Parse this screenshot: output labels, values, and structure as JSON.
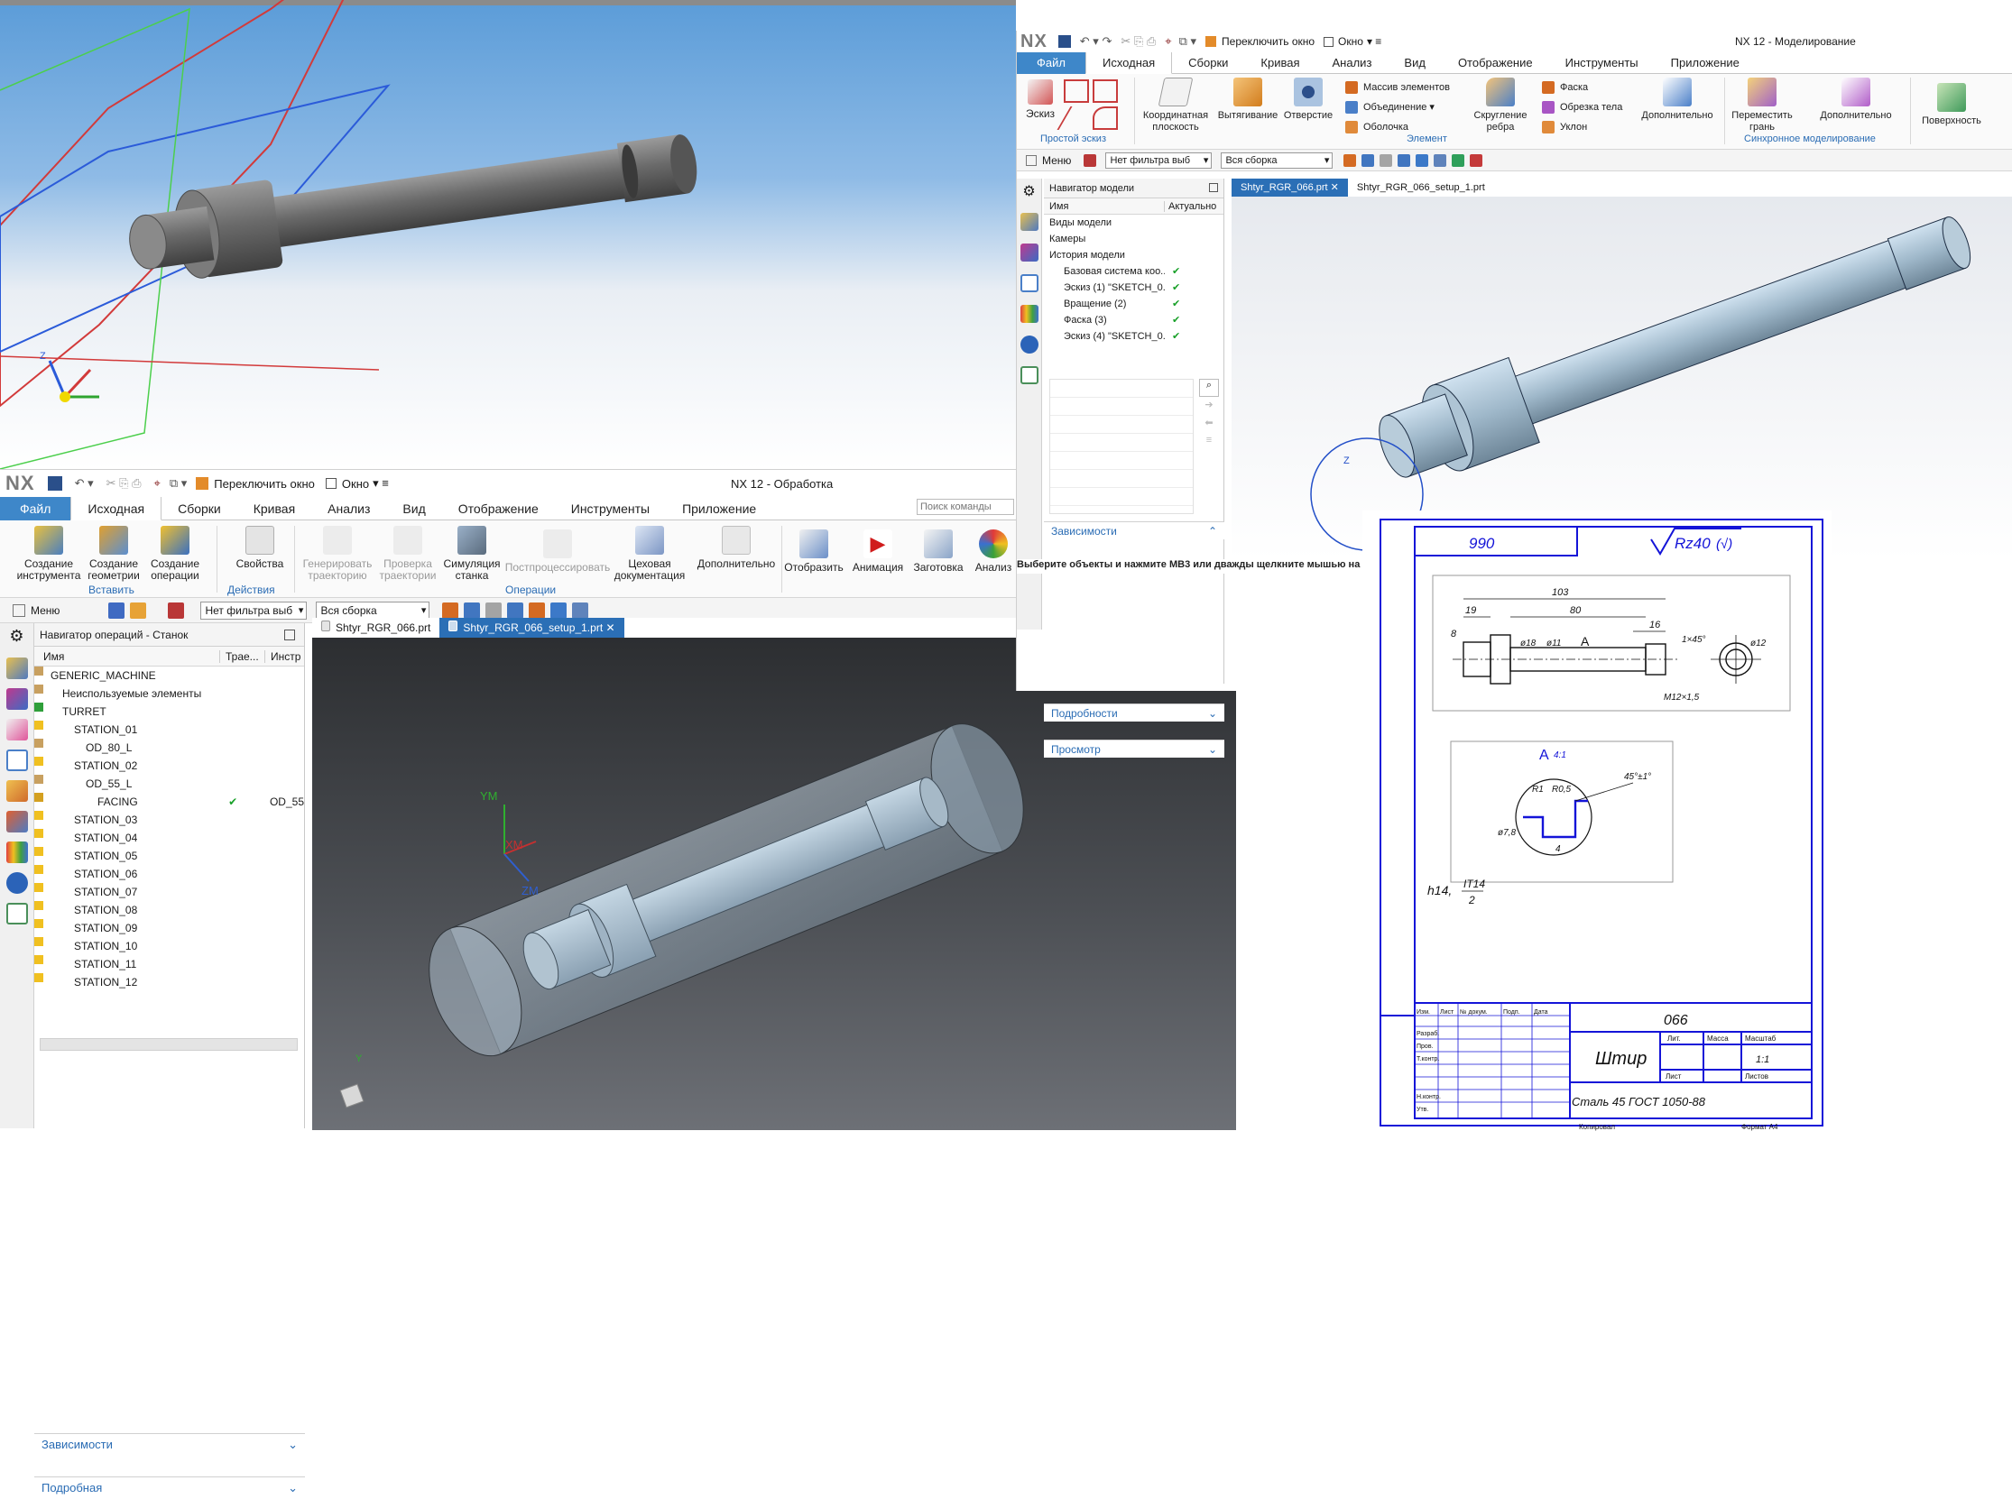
{
  "cam_window": {
    "title": "NX 12 - Обработка",
    "quick": {
      "switch_window": "Переключить окно",
      "window_menu": "Окно"
    },
    "logo": "NX",
    "tabs": [
      "Файл",
      "Исходная",
      "Сборки",
      "Кривая",
      "Анализ",
      "Вид",
      "Отображение",
      "Инструменты",
      "Приложение"
    ],
    "search_placeholder": "Поиск команды",
    "ribbon": {
      "insert": [
        "Создание инструмента",
        "Создание геометрии",
        "Создание операции"
      ],
      "insert_label": "Вставить",
      "actions": [
        "Свойства"
      ],
      "actions_label": "Действия",
      "operations": [
        "Генерировать траекторию",
        "Проверка траектории",
        "Симуляция станка",
        "Постпроцессировать",
        "Цеховая документация",
        "Дополнительно"
      ],
      "operations_label": "Операции",
      "extra": [
        "Отобразить",
        "Анимация",
        "Заготовка",
        "Анализ"
      ]
    },
    "cmdbar": {
      "menu": "Меню",
      "filter": "Нет фильтра выб",
      "assembly": "Вся сборка"
    },
    "navigator": {
      "title": "Навигатор операций - Станок",
      "columns": [
        "Имя",
        "Трае...",
        "Инстр"
      ],
      "rows": [
        {
          "name": "GENERIC_MACHINE",
          "traj": "",
          "tool": ""
        },
        {
          "name": "Неиспользуемые элементы",
          "traj": "",
          "tool": ""
        },
        {
          "name": "TURRET",
          "traj": "",
          "tool": ""
        },
        {
          "name": "STATION_01",
          "traj": "",
          "tool": ""
        },
        {
          "name": "OD_80_L",
          "traj": "",
          "tool": ""
        },
        {
          "name": "STATION_02",
          "traj": "",
          "tool": ""
        },
        {
          "name": "OD_55_L",
          "traj": "",
          "tool": ""
        },
        {
          "name": "FACING",
          "traj": "✔",
          "tool": "OD_55"
        },
        {
          "name": "STATION_03",
          "traj": "",
          "tool": ""
        },
        {
          "name": "STATION_04",
          "traj": "",
          "tool": ""
        },
        {
          "name": "STATION_05",
          "traj": "",
          "tool": ""
        },
        {
          "name": "STATION_06",
          "traj": "",
          "tool": ""
        },
        {
          "name": "STATION_07",
          "traj": "",
          "tool": ""
        },
        {
          "name": "STATION_08",
          "traj": "",
          "tool": ""
        },
        {
          "name": "STATION_09",
          "traj": "",
          "tool": ""
        },
        {
          "name": "STATION_10",
          "traj": "",
          "tool": ""
        },
        {
          "name": "STATION_11",
          "traj": "",
          "tool": ""
        },
        {
          "name": "STATION_12",
          "traj": "",
          "tool": ""
        }
      ],
      "dependencies": "Зависимости",
      "details": "Подробная"
    },
    "doc_tabs": [
      "Shtyr_RGR_066.prt",
      "Shtyr_RGR_066_setup_1.prt"
    ],
    "axis_labels": {
      "ym": "YM",
      "xm": "XM",
      "zm": "ZM",
      "y": "Y"
    }
  },
  "model_window": {
    "title": "NX 12 - Моделирование",
    "quick": {
      "switch_window": "Переключить окно",
      "window_menu": "Окно"
    },
    "logo": "NX",
    "tabs": [
      "Файл",
      "Исходная",
      "Сборки",
      "Кривая",
      "Анализ",
      "Вид",
      "Отображение",
      "Инструменты",
      "Приложение"
    ],
    "ribbon": {
      "sketch": "Эскиз",
      "simple_sketch_label": "Простой эскиз",
      "feature": [
        "Координатная плоскость",
        "Вытягивание",
        "Отверстие"
      ],
      "feature_small": [
        "Массив элементов",
        "Объединение",
        "Оболочка"
      ],
      "edge": "Скругление ребра",
      "edge_small": [
        "Фаска",
        "Обрезка тела",
        "Уклон"
      ],
      "more": "Дополнительно",
      "feature_label": "Элемент",
      "sync": "Переместить грань",
      "sync_more": "Дополнительно",
      "sync_label": "Синхронное моделирование",
      "surface": "Поверхность"
    },
    "cmdbar": {
      "menu": "Меню",
      "filter": "Нет фильтра выб",
      "assembly": "Вся сборка"
    },
    "navigator": {
      "title": "Навигатор модели",
      "columns": [
        "Имя",
        "Актуально"
      ],
      "rows": [
        {
          "name": "Виды модели",
          "ok": ""
        },
        {
          "name": "Камеры",
          "ok": ""
        },
        {
          "name": "История модели",
          "ok": ""
        },
        {
          "name": "Базовая система коо...",
          "ok": "✔"
        },
        {
          "name": "Эскиз (1) \"SKETCH_0...",
          "ok": "✔"
        },
        {
          "name": "Вращение (2)",
          "ok": "✔"
        },
        {
          "name": "Фаска (3)",
          "ok": "✔"
        },
        {
          "name": "Эскиз (4) \"SKETCH_0...",
          "ok": "✔"
        }
      ],
      "dependencies": "Зависимости",
      "details": "Подробности",
      "preview": "Просмотр"
    },
    "doc_tabs": [
      "Shtyr_RGR_066.prt",
      "Shtyr_RGR_066_setup_1.prt"
    ],
    "status": "Выберите объекты и нажмите MB3 или дважды щелкните мышью на"
  },
  "drawing": {
    "number_top": "990",
    "roughness": "Rz40",
    "roughness_paren": "(√)",
    "dims": {
      "total": "103",
      "mid": "80",
      "left": "19",
      "d1": "8",
      "right": "16",
      "chamfer": "1×45°",
      "d18": "ø18",
      "d11": "ø11",
      "d12": "ø12",
      "thread": "M12×1,5"
    },
    "section_letter": "A",
    "section_scale": "4:1",
    "section": {
      "r1": "R1",
      "r05": "R0,5",
      "ch": "45°±1°",
      "d78": "ø7,8",
      "w": "4"
    },
    "tol": "h14,",
    "tol2": "IT14",
    "tol3": "2",
    "stamp": {
      "code": "066",
      "name": "Штир",
      "material": "Сталь 45 ГОСТ 1050-88",
      "mass_scale": "1:1",
      "headers": [
        "Лит.",
        "Масса",
        "Масштаб"
      ],
      "sheet": "Лист",
      "sheets": "Листов",
      "copied": "Копировал",
      "format": "Формат А4",
      "left_rows": [
        "Изм.",
        "Лист",
        "№ докум.",
        "Подп.",
        "Дата",
        "Разраб.",
        "Пров.",
        "Т.контр.",
        "Н.контр.",
        "Утв."
      ]
    }
  },
  "colors": {
    "file_tab": "#3e87c9",
    "accent_blue": "#2a6cb4",
    "drawing_ink": "#1414d8",
    "check": "#18a028"
  }
}
